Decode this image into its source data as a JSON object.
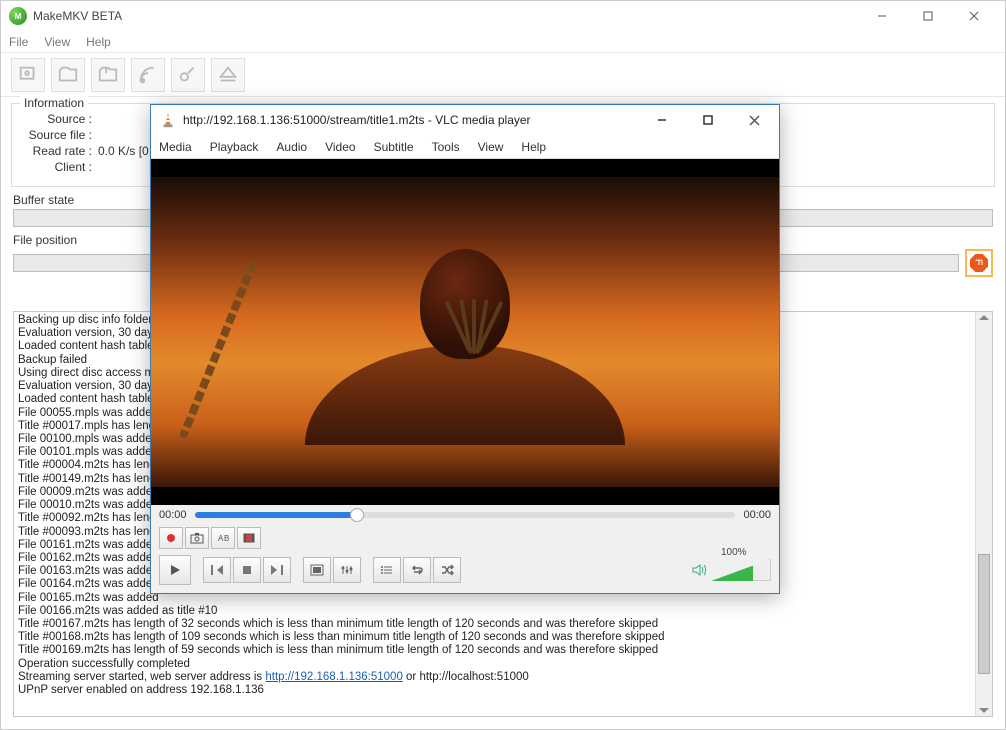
{
  "mkv": {
    "title": "MakeMKV BETA",
    "menu": [
      "File",
      "View",
      "Help"
    ],
    "info": {
      "legend": "Information",
      "source_label": "Source :",
      "sourcefile_label": "Source file :",
      "readrate_label": "Read rate :",
      "readrate_value": "0.0 K/s [0.0X",
      "client_label": "Client :"
    },
    "buffer_label": "Buffer state",
    "filepos_label": "File position",
    "log_lines": "Backing up disc info folder\nEvaluation version, 30 day\nLoaded content hash table\nBackup failed\nUsing direct disc access mo\nEvaluation version, 30 day\nLoaded content hash table\nFile 00055.mpls was added\nTitle #00017.mpls has leng\nFile 00100.mpls was added\nFile 00101.mpls was added\nTitle #00004.m2ts has leng\nTitle #00149.m2ts has leng\nFile 00009.m2ts was added\nFile 00010.m2ts was added\nTitle #00092.m2ts has leng\nTitle #00093.m2ts has leng\nFile 00161.m2ts was added\nFile 00162.m2ts was added\nFile 00163.m2ts was added\nFile 00164.m2ts was added\nFile 00165.m2ts was added\nFile 00166.m2ts was added as title #10\nTitle #00167.m2ts has length of 32 seconds which is less than minimum title length of 120 seconds and was therefore skipped\nTitle #00168.m2ts has length of 109 seconds which is less than minimum title length of 120 seconds and was therefore skipped\nTitle #00169.m2ts has length of 59 seconds which is less than minimum title length of 120 seconds and was therefore skipped\nOperation successfully completed",
    "log_stream_prefix": "Streaming server started, web server address is ",
    "log_stream_link": "http://192.168.1.136:51000",
    "log_stream_suffix": " or http://localhost:51000",
    "log_upnp": "UPnP server enabled on address 192.168.1.136"
  },
  "vlc": {
    "title": "http://192.168.1.136:51000/stream/title1.m2ts - VLC media player",
    "menu": [
      "Media",
      "Playback",
      "Audio",
      "Video",
      "Subtitle",
      "Tools",
      "View",
      "Help"
    ],
    "time_left": "00:00",
    "time_right": "00:00",
    "volume_label": "100%"
  }
}
